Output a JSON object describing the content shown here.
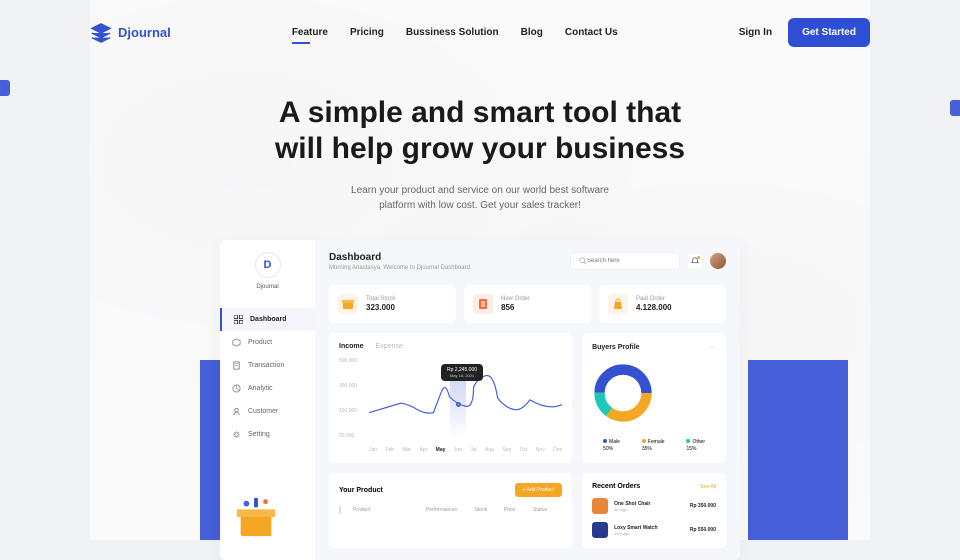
{
  "brand": {
    "name": "Djournal"
  },
  "nav": {
    "items": [
      "Feature",
      "Pricing",
      "Bussiness Solution",
      "Blog",
      "Contact Us"
    ],
    "active_index": 0,
    "signin": "Sign In",
    "cta": "Get Started"
  },
  "hero": {
    "title_line1": "A simple and smart tool that",
    "title_line2": "will  help grow your business",
    "sub_line1": "Learn your product and service on our world best software",
    "sub_line2": "platform with low cost. Get your sales tracker!"
  },
  "dashboard": {
    "sidebar": {
      "logo_letter": "D",
      "logo_text": "Djournal",
      "items": [
        {
          "label": "Dashboard",
          "icon": "grid"
        },
        {
          "label": "Product",
          "icon": "cube"
        },
        {
          "label": "Transaction",
          "icon": "doc"
        },
        {
          "label": "Analytic",
          "icon": "chart"
        },
        {
          "label": "Customer",
          "icon": "user"
        },
        {
          "label": "Setting",
          "icon": "gear"
        }
      ],
      "active_index": 0
    },
    "header": {
      "title": "Dashboard",
      "subtitle": "Morning Anastasya, Welcome to Djournal  Dashboard.",
      "search_placeholder": "Search here"
    },
    "stats": [
      {
        "label": "Total Stock",
        "value": "323.000",
        "icon": "box",
        "color": "#f5a623"
      },
      {
        "label": "New Order",
        "value": "856",
        "icon": "list",
        "color": "#f56b3d"
      },
      {
        "label": "Paid Order",
        "value": "4.128.000",
        "icon": "bag",
        "color": "#f5a623"
      }
    ],
    "chart": {
      "tabs": [
        "Income",
        "Expense"
      ],
      "active_tab": 0,
      "tooltip_value": "Rp 2,245.000",
      "tooltip_date": "May 18, 2021",
      "y_ticks": [
        "500.000",
        "300.000",
        "150.000",
        "50.000"
      ],
      "x_ticks": [
        "Jan",
        "Feb",
        "Mar",
        "Apr",
        "May",
        "Jun",
        "Jul",
        "Aug",
        "Sep",
        "Oct",
        "Nov",
        "Des"
      ],
      "active_month_index": 4
    },
    "buyers_profile": {
      "title": "Buyers Profile",
      "segments": [
        {
          "label": "Male",
          "value": "50%",
          "color": "#3451d1"
        },
        {
          "label": "Female",
          "value": "35%",
          "color": "#f5a623"
        },
        {
          "label": "Other",
          "value": "15%",
          "color": "#1cc8b8"
        }
      ]
    },
    "product_table": {
      "title": "Your Product",
      "add_label": "+  Add Product",
      "columns": [
        "Product",
        "Performances",
        "Stock",
        "Price",
        "Status"
      ]
    },
    "recent_orders": {
      "title": "Recent Orders",
      "see_all": "See All",
      "items": [
        {
          "name": "One Shot Chair",
          "time": "5m ago",
          "price": "Rp 350.000",
          "thumb_color": "#e8873a"
        },
        {
          "name": "Loxy Smart Watch",
          "time": "10m ago",
          "price": "Rp 550.000",
          "thumb_color": "#2a3a8f"
        }
      ]
    }
  },
  "chart_data": {
    "type": "line",
    "title": "Income",
    "xlabel": "",
    "ylabel": "",
    "ylim": [
      0,
      500000
    ],
    "categories": [
      "Jan",
      "Feb",
      "Mar",
      "Apr",
      "May",
      "Jun",
      "Jul",
      "Aug",
      "Sep",
      "Oct",
      "Nov",
      "Des"
    ],
    "series": [
      {
        "name": "Income",
        "values": [
          80000,
          120000,
          160000,
          100000,
          260000,
          160000,
          300000,
          350000,
          170000,
          130000,
          190000,
          150000
        ]
      }
    ],
    "highlight": {
      "category": "May",
      "value": 2245000,
      "label": "Rp 2,245.000",
      "date": "May 18, 2021"
    }
  }
}
